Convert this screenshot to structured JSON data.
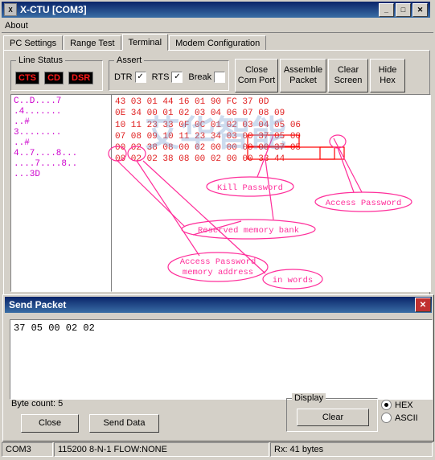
{
  "window": {
    "title": "X-CTU    [COM3]",
    "icon": "terminal-icon",
    "minimize": "_",
    "maximize": "□",
    "close": "✕",
    "menu": [
      "About"
    ]
  },
  "tabs": [
    {
      "label": "PC Settings",
      "active": false
    },
    {
      "label": "Range Test",
      "active": false
    },
    {
      "label": "Terminal",
      "active": true
    },
    {
      "label": "Modem Configuration",
      "active": false
    }
  ],
  "line_status": {
    "title": "Line Status",
    "leds": [
      "CTS",
      "CD",
      "DSR"
    ]
  },
  "assert": {
    "title": "Assert",
    "checks": [
      {
        "label": "DTR",
        "checked": true
      },
      {
        "label": "RTS",
        "checked": true
      },
      {
        "label": "Break",
        "checked": false
      }
    ],
    "check_glyph": "✓"
  },
  "buttons": [
    {
      "name": "close-com-port-button",
      "line1": "Close",
      "line2": "Com Port"
    },
    {
      "name": "assemble-packet-button",
      "line1": "Assemble",
      "line2": "Packet"
    },
    {
      "name": "clear-screen-button",
      "line1": "Clear",
      "line2": "Screen"
    },
    {
      "name": "hide-hex-button",
      "line1": "Hide",
      "line2": "Hex"
    }
  ],
  "terminal": {
    "ascii_text": "C..D....7\n.4.......\n..#\n3........\n..#\n4..7....8...\n....7....8..\n...3D",
    "hex_text": "43 03 01 44 16 01 90 FC 37 0D\n0E 34 00 01 02 03 04 06 07 08 09\n10 11 23 33 0F 0C 01 02 03 04 05 06\n07 08 09 10 11 23 34 03 00 37 05 00\n00 02 38 08 00 02 00 00 00 00 37 05\n00 02 02 38 08 00 02 00 00 33 44"
  },
  "annotations": [
    {
      "name": "kill-password-label",
      "text": "Kill Password"
    },
    {
      "name": "access-password-label",
      "text": "Access Password"
    },
    {
      "name": "reserved-memory-bank-label",
      "text": "Reserved memory bank"
    },
    {
      "name": "access-password-memory-address-label",
      "text": "Access Password\nmemory address"
    },
    {
      "name": "in-words-label",
      "text": "in words"
    }
  ],
  "dialog": {
    "title": "Send Packet",
    "close": "✕",
    "input_value": "37 05 00 02 02",
    "byte_count": "Byte count: 5",
    "close_button": "Close",
    "send_button": "Send Data",
    "display_group": "Display",
    "clear_button": "Clear",
    "radios": [
      {
        "label": "HEX",
        "selected": true
      },
      {
        "label": "ASCII",
        "selected": false
      }
    ]
  },
  "statusbar": {
    "port": "COM3",
    "settings": "115200 8-N-1  FLOW:NONE",
    "rx": "Rx: 41 bytes"
  },
  "watermark": "艾华智能",
  "colors": {
    "led_text": "#ff1a1a",
    "hex_text": "#e02020",
    "ascii_text": "#cc00cc",
    "annotation": "#ff2e9a",
    "titlebar": "#0a246a"
  }
}
